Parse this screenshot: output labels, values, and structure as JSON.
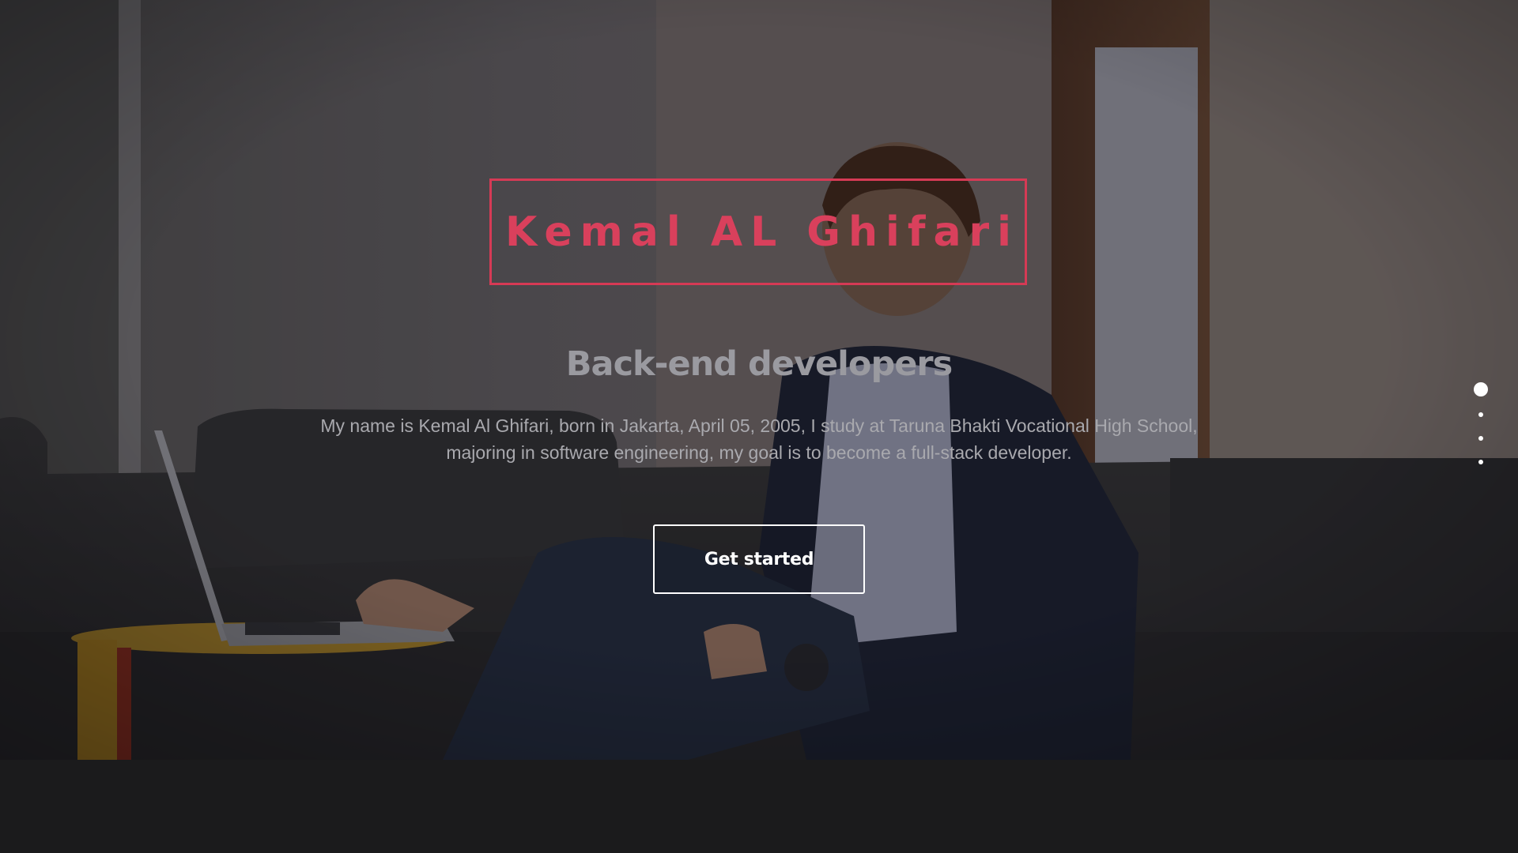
{
  "hero": {
    "name": "Kemal AL Ghifari",
    "subtitle": "Back-end developers",
    "description": "My name is Kemal Al Ghifari, born in Jakarta, April 05, 2005, I study at Taruna Bhakti Vocational High School, majoring in software engineering, my goal is to become a full-stack developer.",
    "cta_label": "Get started",
    "background_image": "person-with-laptop-photo"
  },
  "slide_nav": {
    "count": 4,
    "active_index": 0
  },
  "colors": {
    "accent": "#d9405c",
    "subtitle": "#9a9aa0",
    "body_text": "#a9a9ae",
    "button_border": "#ffffff",
    "footer_background": "#1b1b1c"
  }
}
